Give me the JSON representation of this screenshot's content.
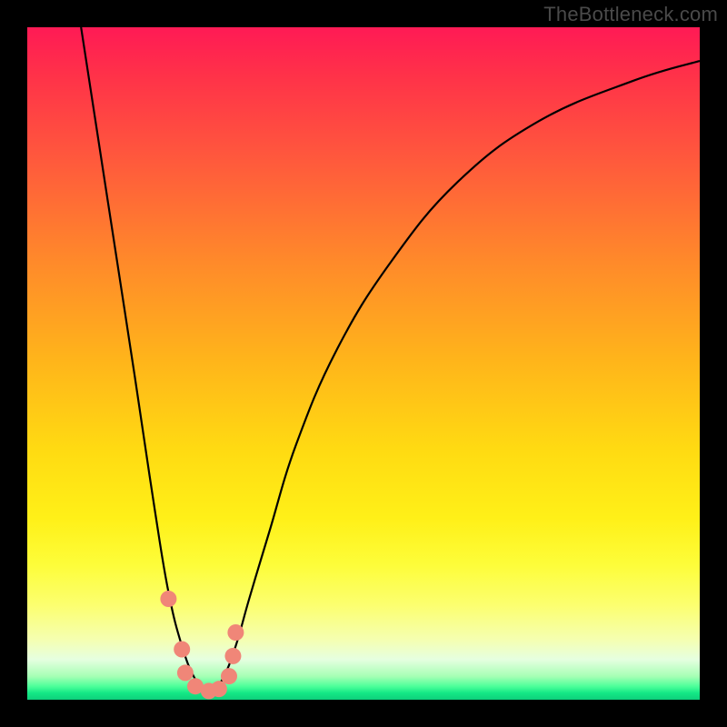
{
  "watermark": "TheBottleneck.com",
  "colors": {
    "frame": "#000000",
    "curve": "#000000",
    "dot_fill": "#f08678",
    "dot_stroke": "#d96a5c"
  },
  "chart_data": {
    "type": "line",
    "title": "",
    "xlabel": "",
    "ylabel": "",
    "xlim": [
      0,
      100
    ],
    "ylim": [
      0,
      100
    ],
    "note": "Percent-of-plot coordinates; higher y = higher on screen. V-shaped bottleneck curve with minimum near x≈27.",
    "series": [
      {
        "name": "bottleneck-curve",
        "x": [
          8,
          12,
          16,
          19,
          21,
          23,
          25,
          27,
          29,
          31,
          33,
          36,
          40,
          46,
          54,
          64,
          76,
          90,
          100
        ],
        "y": [
          100,
          74,
          48,
          28,
          16,
          8,
          3,
          1,
          3,
          8,
          15,
          25,
          38,
          52,
          65,
          77,
          86,
          92,
          95
        ]
      }
    ],
    "points": [
      {
        "name": "p1",
        "x": 21.0,
        "y": 15.0
      },
      {
        "name": "p2",
        "x": 23.0,
        "y": 7.5
      },
      {
        "name": "p3",
        "x": 23.5,
        "y": 4.0
      },
      {
        "name": "p4",
        "x": 25.0,
        "y": 2.0
      },
      {
        "name": "p5",
        "x": 27.0,
        "y": 1.3
      },
      {
        "name": "p6",
        "x": 28.5,
        "y": 1.6
      },
      {
        "name": "p7",
        "x": 30.0,
        "y": 3.5
      },
      {
        "name": "p8",
        "x": 30.6,
        "y": 6.5
      },
      {
        "name": "p9",
        "x": 31.0,
        "y": 10.0
      }
    ]
  }
}
